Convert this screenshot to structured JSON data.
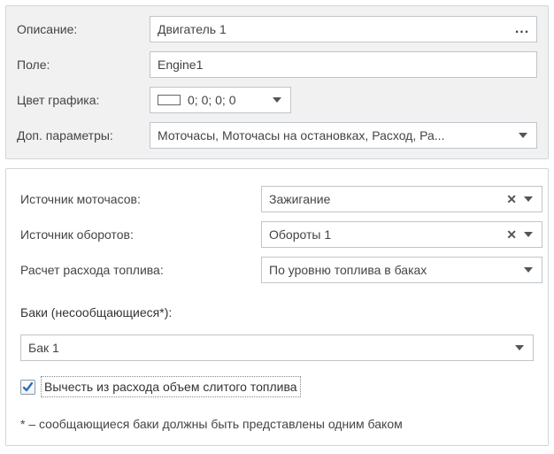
{
  "top": {
    "description": {
      "label": "Описание:",
      "value": "Двигатель 1"
    },
    "field": {
      "label": "Поле:",
      "value": "Engine1"
    },
    "chartColor": {
      "label": "Цвет графика:",
      "value": "0; 0; 0; 0"
    },
    "extraParams": {
      "label": "Доп. параметры:",
      "value": "Моточасы, Моточасы на остановках, Расход, Ра..."
    }
  },
  "bottom": {
    "motorhoursSource": {
      "label": "Источник моточасов:",
      "value": "Зажигание"
    },
    "rpmSource": {
      "label": "Источник оборотов:",
      "value": "Обороты 1"
    },
    "fuelCalculation": {
      "label": "Расчет расхода топлива:",
      "value": "По уровню топлива в баках"
    },
    "tanksLabel": "Баки (несообщающиеся*):",
    "tank": {
      "value": "Бак 1"
    },
    "subtractDrained": {
      "label": "Вычесть из расхода объем слитого топлива",
      "checked": true
    },
    "footnote": "* – сообщающиеся баки должны быть представлены одним баком"
  },
  "icons": {
    "ellipsis": "...",
    "clear": "✕"
  }
}
